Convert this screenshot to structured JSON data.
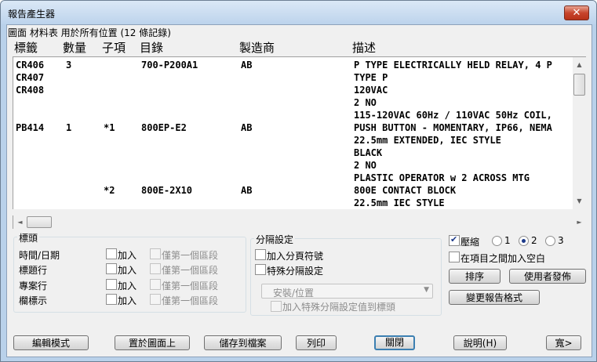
{
  "window": {
    "title": "報告產生器",
    "close_glyph": "✕"
  },
  "caption": "圖面 材料表 用於所有位置 (12 條記錄)",
  "columns": [
    "標籤",
    "數量",
    "子項",
    "目錄",
    "製造商",
    "描述"
  ],
  "rows": [
    {
      "tag": "CR406",
      "qty": "3",
      "sub": "",
      "catalog": "700-P200A1",
      "mfr": "AB",
      "desc": "P TYPE ELECTRICALLY HELD RELAY, 4 P"
    },
    {
      "tag": "CR407",
      "qty": "",
      "sub": "",
      "catalog": "",
      "mfr": "",
      "desc": "TYPE P"
    },
    {
      "tag": "CR408",
      "qty": "",
      "sub": "",
      "catalog": "",
      "mfr": "",
      "desc": "120VAC"
    },
    {
      "tag": "",
      "qty": "",
      "sub": "",
      "catalog": "",
      "mfr": "",
      "desc": "2 NO"
    },
    {
      "tag": "",
      "qty": "",
      "sub": "",
      "catalog": "",
      "mfr": "",
      "desc": "115-120VAC 60Hz / 110VAC 50Hz COIL,"
    },
    {
      "tag": "PB414",
      "qty": "1",
      "sub": "*1",
      "catalog": "800EP-E2",
      "mfr": "AB",
      "desc": "PUSH BUTTON - MOMENTARY, IP66, NEMA"
    },
    {
      "tag": "",
      "qty": "",
      "sub": "",
      "catalog": "",
      "mfr": "",
      "desc": "22.5mm EXTENDED, IEC STYLE"
    },
    {
      "tag": "",
      "qty": "",
      "sub": "",
      "catalog": "",
      "mfr": "",
      "desc": "BLACK"
    },
    {
      "tag": "",
      "qty": "",
      "sub": "",
      "catalog": "",
      "mfr": "",
      "desc": "2 NO"
    },
    {
      "tag": "",
      "qty": "",
      "sub": "",
      "catalog": "",
      "mfr": "",
      "desc": "PLASTIC OPERATOR w 2 ACROSS MTG"
    },
    {
      "tag": "",
      "qty": "",
      "sub": "*2",
      "catalog": "800E-2X10",
      "mfr": "AB",
      "desc": "800E CONTACT BLOCK"
    },
    {
      "tag": "",
      "qty": "",
      "sub": "",
      "catalog": "",
      "mfr": "",
      "desc": "22.5mm IEC STYLE"
    }
  ],
  "header_group": {
    "label": "標頭",
    "rows": [
      {
        "label": "時間/日期",
        "add": "加入",
        "first_only": "僅第一個區段"
      },
      {
        "label": "標題行",
        "add": "加入",
        "first_only": "僅第一個區段"
      },
      {
        "label": "專案行",
        "add": "加入",
        "first_only": "僅第一個區段"
      },
      {
        "label": "欄標示",
        "add": "加入",
        "first_only": "僅第一個區段"
      }
    ]
  },
  "separator_group": {
    "label": "分隔設定",
    "page_break": "加入分頁符號",
    "special": "特殊分隔設定",
    "select_value": "安裝/位置",
    "add_to_header": "加入特殊分隔設定值到標頭"
  },
  "options": {
    "compress": "壓縮",
    "compress_checked": true,
    "radio_options": [
      "1",
      "2",
      "3"
    ],
    "radio_selected": "2",
    "blank_between": "在項目之間加入空白",
    "sort_button": "排序",
    "user_publish_button": "使用者發佈",
    "change_format_button": "變更報告格式"
  },
  "buttons": {
    "edit_mode": "編輯模式",
    "place_on_drawing": "置於圖面上",
    "save_to_file": "儲存到檔案",
    "print": "列印",
    "close": "關閉",
    "help": "說明(H)",
    "wide": "寬>"
  },
  "scroll_glyphs": {
    "up": "▲",
    "down": "▼",
    "left": "◄",
    "right": "►"
  }
}
